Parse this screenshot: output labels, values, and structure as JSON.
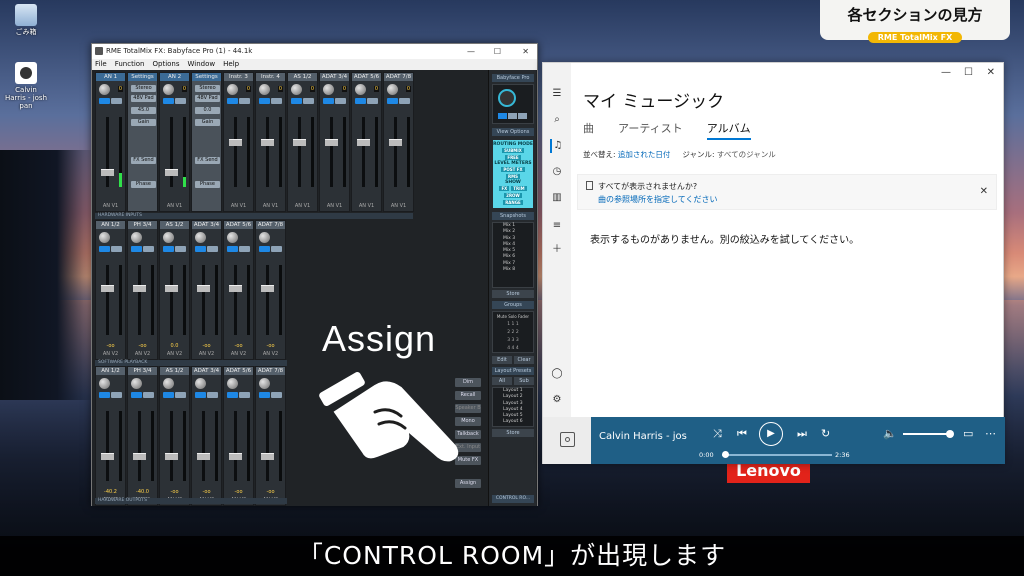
{
  "desktop": {
    "icons": [
      {
        "label": "ごみ箱"
      },
      {
        "label": "Calvin Harris - josh pan"
      }
    ]
  },
  "banner": {
    "title": "各セクションの見方",
    "tag": "RME TotalMix FX"
  },
  "subtitle": "「CONTROL ROOM」が出現します",
  "overlay": {
    "assign_text": "Assign"
  },
  "brand": "Lenovo",
  "totalmix": {
    "window_title": "RME TotalMix FX: Babyface Pro (1) - 44.1k",
    "menu": [
      "File",
      "Function",
      "Options",
      "Window",
      "Help"
    ],
    "hardware_inputs_label": "HARDWARE INPUTS",
    "software_playback_label": "SOFTWARE PLAYBACK",
    "hardware_outputs_label": "HARDWARE OUTPUTS",
    "inputs": [
      {
        "name": "AN 1",
        "foot": "AN V1",
        "kval": "0"
      },
      {
        "name": "AN 2",
        "foot": "AN V1",
        "kval": "0"
      },
      {
        "name": "Instr. 3",
        "foot": "AN V1",
        "kval": "0"
      },
      {
        "name": "Instr. 4",
        "foot": "AN V1",
        "kval": "0"
      },
      {
        "name": "AS 1/2",
        "foot": "AN V1",
        "kval": "0"
      },
      {
        "name": "ADAT 3/4",
        "foot": "AN V1",
        "kval": "0"
      },
      {
        "name": "ADAT 5/6",
        "foot": "AN V1",
        "kval": "0"
      },
      {
        "name": "ADAT 7/8",
        "foot": "AN V1",
        "kval": "0"
      }
    ],
    "settings": {
      "label": "Settings",
      "stereo": "Stereo",
      "v48": "48V",
      "pad": "Pad",
      "gain": "45.0",
      "gain_label": "Gain",
      "fx": "FX Send",
      "phase": "Phase"
    },
    "settings2": {
      "gain": "0.0"
    },
    "playback": [
      {
        "name": "AN 1/2",
        "foot": "AN V2",
        "gval": "-oo"
      },
      {
        "name": "PH 3/4",
        "foot": "AN V2",
        "gval": "-oo"
      },
      {
        "name": "AS 1/2",
        "foot": "AN V2",
        "gval": "0.0"
      },
      {
        "name": "ADAT 3/4",
        "foot": "AN V2",
        "gval": "-oo"
      },
      {
        "name": "ADAT 5/6",
        "foot": "AN V2",
        "gval": "-oo"
      },
      {
        "name": "ADAT 7/8",
        "foot": "AN V2",
        "gval": "-oo"
      }
    ],
    "outputs": [
      {
        "name": "AN 1/2",
        "foot": "AN V2",
        "gval": "-40.2"
      },
      {
        "name": "PH 3/4",
        "foot": "AN V2",
        "gval": "-40.0"
      },
      {
        "name": "AS 1/2",
        "foot": "AN V2",
        "gval": "-oo"
      },
      {
        "name": "ADAT 3/4",
        "foot": "AN V2",
        "gval": "-oo"
      },
      {
        "name": "ADAT 5/6",
        "foot": "AN V2",
        "gval": "-oo"
      },
      {
        "name": "ADAT 7/8",
        "foot": "AN V2",
        "gval": "-oo"
      }
    ],
    "right_panel": {
      "device": "Babyface Pro",
      "view_options": "View Options",
      "routing_mode": "ROUTING MODE",
      "submix": "SUBMIX",
      "free": "FREE",
      "level_meters": "LEVEL METERS",
      "postfx": "POST FX",
      "rms": "RMS",
      "show": "SHOW",
      "show_btns": [
        "FX",
        "TRIM",
        "2ROW",
        "RANGE"
      ],
      "snapshots": "Snapshots",
      "snapshot_items": [
        "Mix 1",
        "Mix 2",
        "Mix 3",
        "Mix 4",
        "Mix 5",
        "Mix 6",
        "Mix 7",
        "Mix 8"
      ],
      "store": "Store",
      "groups": "Groups",
      "groups_cols": "Mute  Solo  Fader",
      "edit": "Edit",
      "clear": "Clear",
      "layout_presets": "Layout Presets",
      "all": "All",
      "sub": "Sub",
      "layouts": [
        "Layout 1",
        "Layout 2",
        "Layout 3",
        "Layout 4",
        "Layout 5",
        "Layout 6"
      ],
      "store2": "Store",
      "control_room": "CONTROL RO..."
    },
    "cr_buttons": [
      "Dim",
      "Recall",
      "Speaker B",
      "Mono",
      "Talkback",
      "Ext. Input",
      "Mute FX"
    ],
    "assign": "Assign"
  },
  "music": {
    "title": "マイ ミュージック",
    "tabs": [
      "曲",
      "アーティスト",
      "アルバム"
    ],
    "active_tab": 2,
    "filter_label": "並べ替え:",
    "filter_value": "追加された日付",
    "genre_label": "ジャンル:",
    "genre_value": "すべてのジャンル",
    "notice_line1": "すべてが表示されませんか?",
    "notice_line2": "曲の参照場所を指定してください",
    "empty_text": "表示するものがありません。別の絞込みを試してください。",
    "player": {
      "title": "Calvin Harris - josh p",
      "time_start": "0:00",
      "time_end": "2:36",
      "progress": 0.0,
      "volume": 1.0
    }
  }
}
